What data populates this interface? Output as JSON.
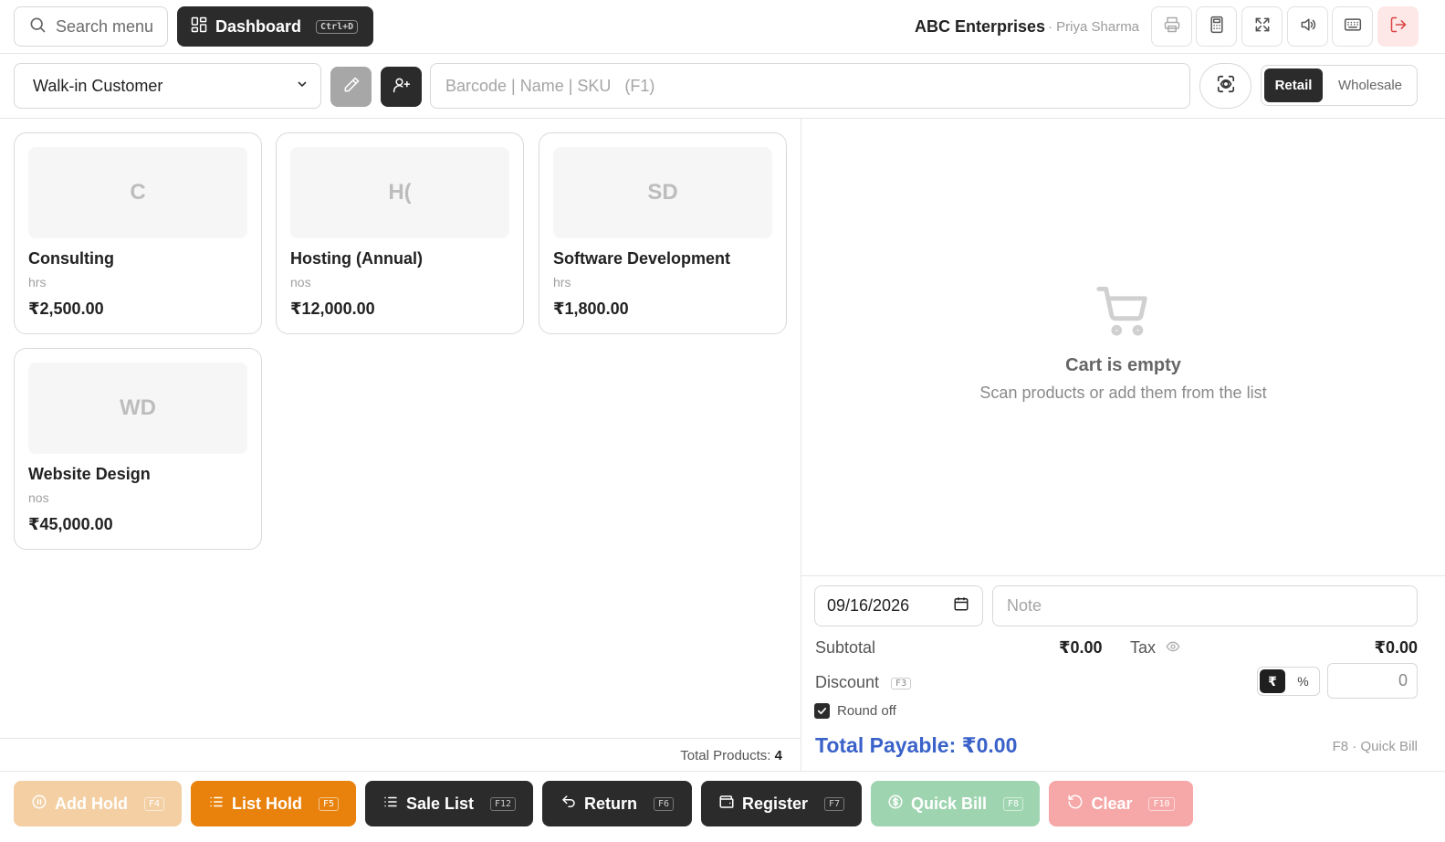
{
  "topbar": {
    "search_label": "Search menu",
    "dashboard_label": "Dashboard",
    "dashboard_shortcut": "Ctrl+D",
    "company": "ABC Enterprises",
    "user": "· Priya Sharma",
    "icons": [
      "printer-icon",
      "calculator-icon",
      "fullscreen-icon",
      "volume-icon",
      "keyboard-icon",
      "logout-icon"
    ]
  },
  "toolbar": {
    "customer_selected": "Walk-in Customer",
    "barcode_placeholder": "Barcode | Name | SKU   (F1)",
    "mode_retail": "Retail",
    "mode_wholesale": "Wholesale",
    "mode_selected": "Retail"
  },
  "products": [
    {
      "initials": "C",
      "name": "Consulting",
      "unit": "hrs",
      "price": "₹2,500.00"
    },
    {
      "initials": "H(",
      "name": "Hosting (Annual)",
      "unit": "nos",
      "price": "₹12,000.00"
    },
    {
      "initials": "SD",
      "name": "Software Development",
      "unit": "hrs",
      "price": "₹1,800.00"
    },
    {
      "initials": "WD",
      "name": "Website Design",
      "unit": "nos",
      "price": "₹45,000.00"
    }
  ],
  "product_footer": {
    "total_label": "Total Products:",
    "total_count": "4"
  },
  "cart": {
    "empty_title": "Cart is empty",
    "empty_subtitle": "Scan products or add them from the list"
  },
  "summary": {
    "date": "09/16/2026",
    "note_placeholder": "Note",
    "subtotal_label": "Subtotal",
    "subtotal_value": "₹0.00",
    "tax_label": "Tax",
    "tax_value": "₹0.00",
    "discount_label": "Discount",
    "discount_shortcut": "F3",
    "discount_rupee": "₹",
    "discount_percent": "%",
    "discount_value": "0",
    "roundoff_label": "Round off",
    "roundoff_checked": true,
    "total_payable": "Total Payable: ₹0.00",
    "quickbill_hint": "F8 · Quick Bill"
  },
  "actions": {
    "add_hold": {
      "label": "Add Hold",
      "key": "F4"
    },
    "list_hold": {
      "label": "List Hold",
      "key": "F5"
    },
    "sale_list": {
      "label": "Sale List",
      "key": "F12"
    },
    "return": {
      "label": "Return",
      "key": "F6"
    },
    "register": {
      "label": "Register",
      "key": "F7"
    },
    "quick_bill": {
      "label": "Quick Bill",
      "key": "F8"
    },
    "clear": {
      "label": "Clear",
      "key": "F10"
    }
  },
  "colors": {
    "dark": "#2b2b2b",
    "accent_blue": "#3a62c9",
    "orange": "#e8820c",
    "green_disabled": "#9fd4b0",
    "red_disabled": "#f6a7a7",
    "orange_disabled": "#f3cfa3"
  }
}
